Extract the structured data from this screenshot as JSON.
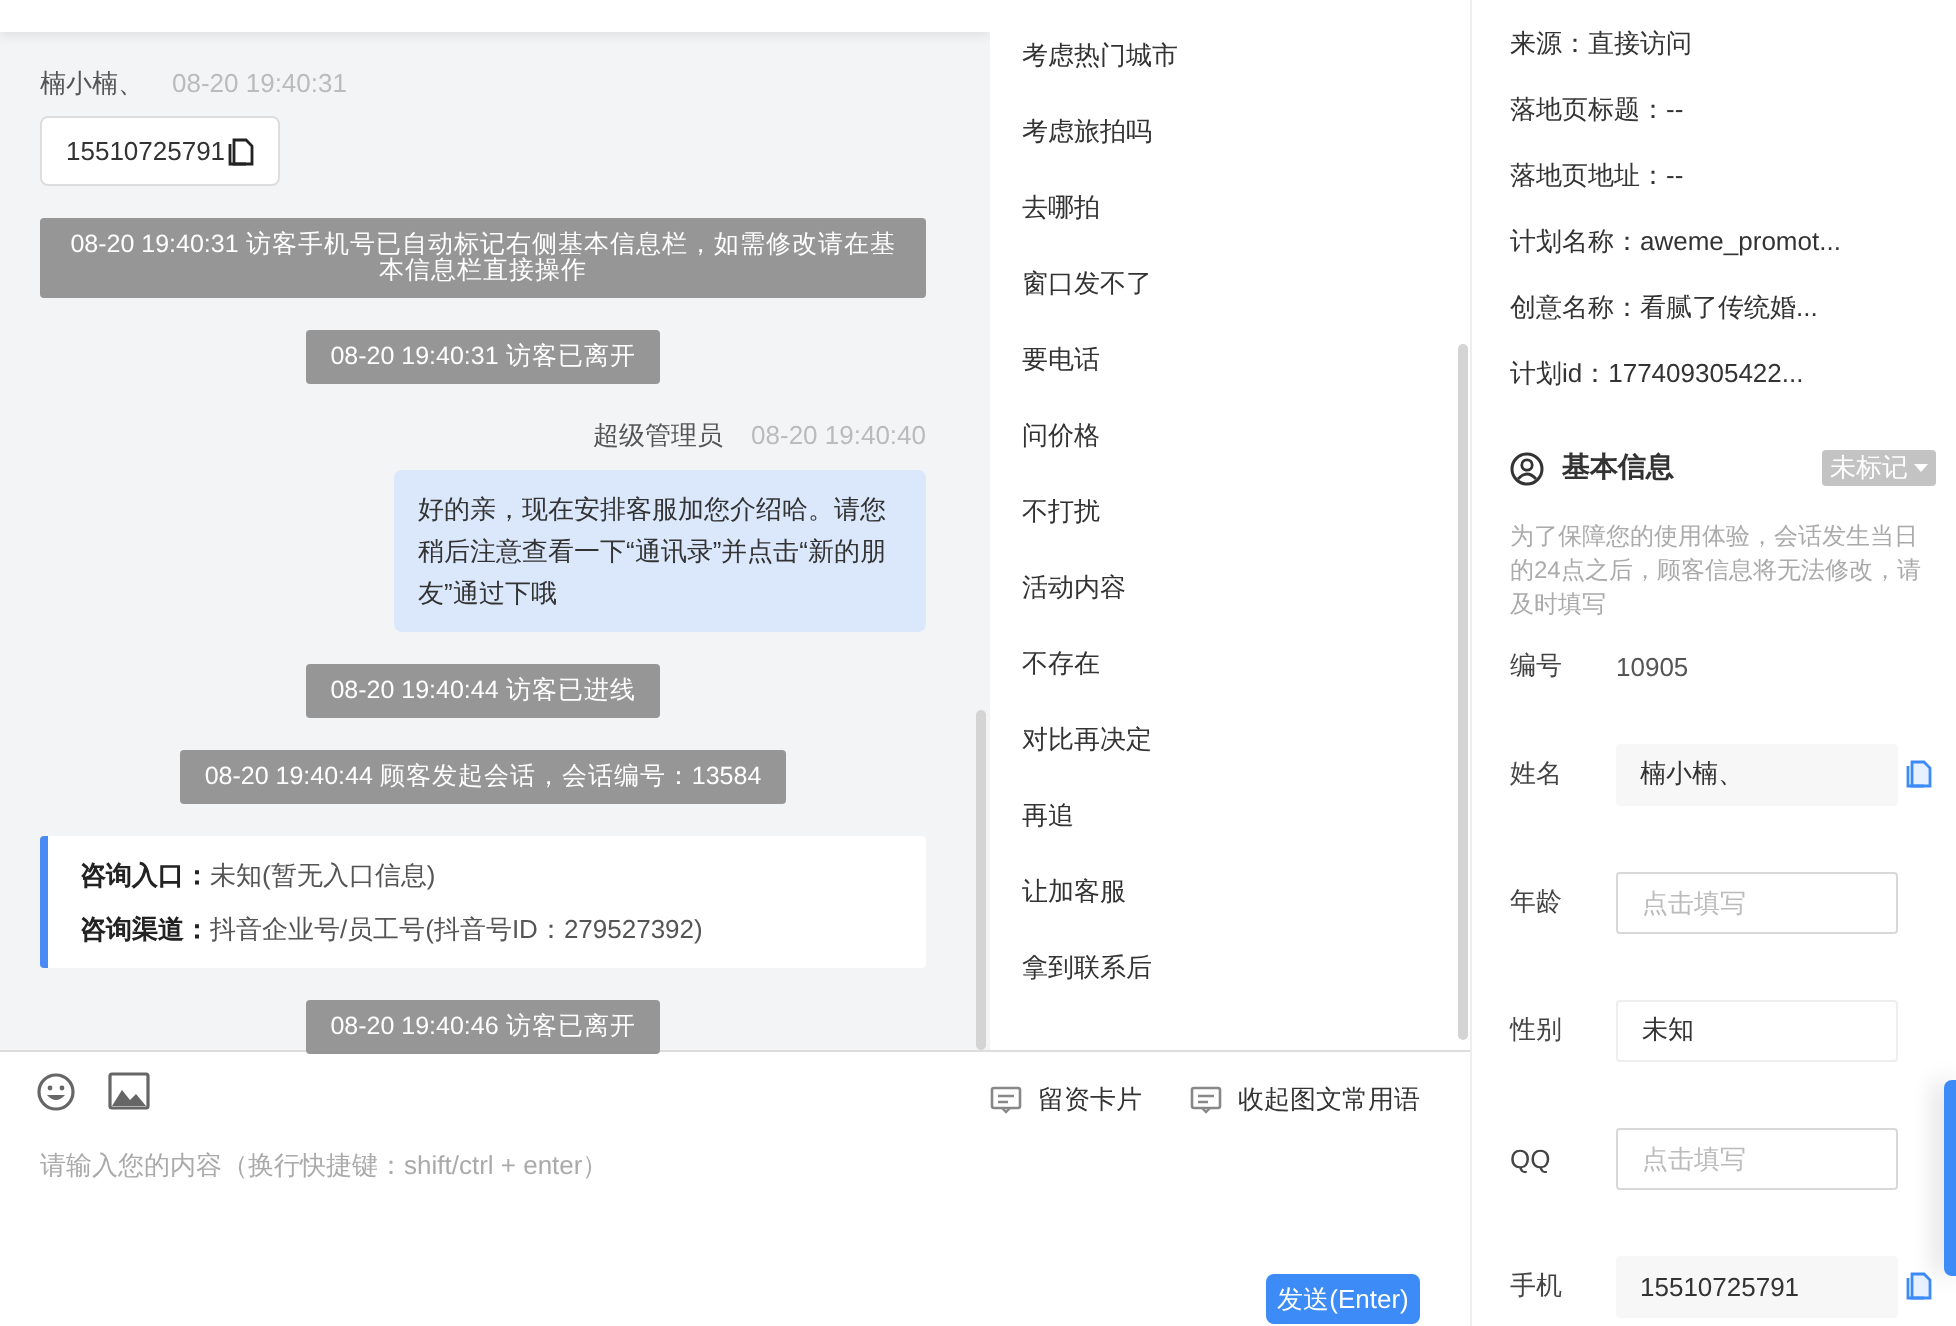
{
  "chat": {
    "messages": [
      {
        "kind": "visitor",
        "sender": "楠小楠、",
        "time": "08-20 19:40:31",
        "text": "15510725791"
      },
      {
        "kind": "system",
        "text": "08-20 19:40:31 访客手机号已自动标记右侧基本信息栏，如需修改请在基本信息栏直接操作"
      },
      {
        "kind": "system",
        "text": "08-20 19:40:31 访客已离开"
      },
      {
        "kind": "agent",
        "sender": "超级管理员",
        "time": "08-20 19:40:40",
        "text": "好的亲，现在安排客服加您介绍哈。请您稍后注意查看一下“通讯录”并点击“新的朋友”通过下哦"
      },
      {
        "kind": "system",
        "text": "08-20 19:40:44 访客已进线"
      },
      {
        "kind": "system",
        "text": "08-20 19:40:44 顾客发起会话，会话编号：13584"
      },
      {
        "kind": "entry",
        "rows": [
          {
            "label": "咨询入口：",
            "value": "未知(暂无入口信息)"
          },
          {
            "label": "咨询渠道：",
            "value": "抖音企业号/员工号(抖音号ID：279527392)"
          }
        ]
      },
      {
        "kind": "system",
        "text": "08-20 19:40:46 访客已离开"
      }
    ]
  },
  "phrases": [
    "考虑热门城市",
    "考虑旅拍吗",
    "去哪拍",
    "窗口发不了",
    "要电话",
    "问价格",
    "不打扰",
    "活动内容",
    "不存在",
    "对比再决定",
    "再追",
    "让加客服",
    "拿到联系后"
  ],
  "composer": {
    "tools": [
      {
        "label": "留资卡片"
      },
      {
        "label": "收起图文常用语"
      }
    ],
    "placeholder": "请输入您的内容（换行快捷键：shift/ctrl + enter）",
    "send": "发送(Enter)"
  },
  "info": {
    "source_rows": [
      "来源：直接访问",
      "落地页标题：--",
      "落地页地址：--",
      "计划名称：aweme_promot...",
      "创意名称：看腻了传统婚...",
      "计划id：177409305422..."
    ],
    "section_title": "基本信息",
    "tag": "未标记",
    "notice": "为了保障您的使用体验，会话发生当日的24点之后，顾客信息将无法修改，请及时填写",
    "fields": [
      {
        "kind": "text",
        "label": "编号",
        "value": "10905"
      },
      {
        "kind": "copy",
        "label": "姓名",
        "value": "楠小楠、"
      },
      {
        "kind": "input",
        "label": "年龄",
        "placeholder": "点击填写"
      },
      {
        "kind": "box",
        "label": "性别",
        "value": "未知"
      },
      {
        "kind": "input",
        "label": "QQ",
        "placeholder": "点击填写"
      },
      {
        "kind": "copy",
        "label": "手机",
        "value": "15510725791"
      }
    ]
  }
}
